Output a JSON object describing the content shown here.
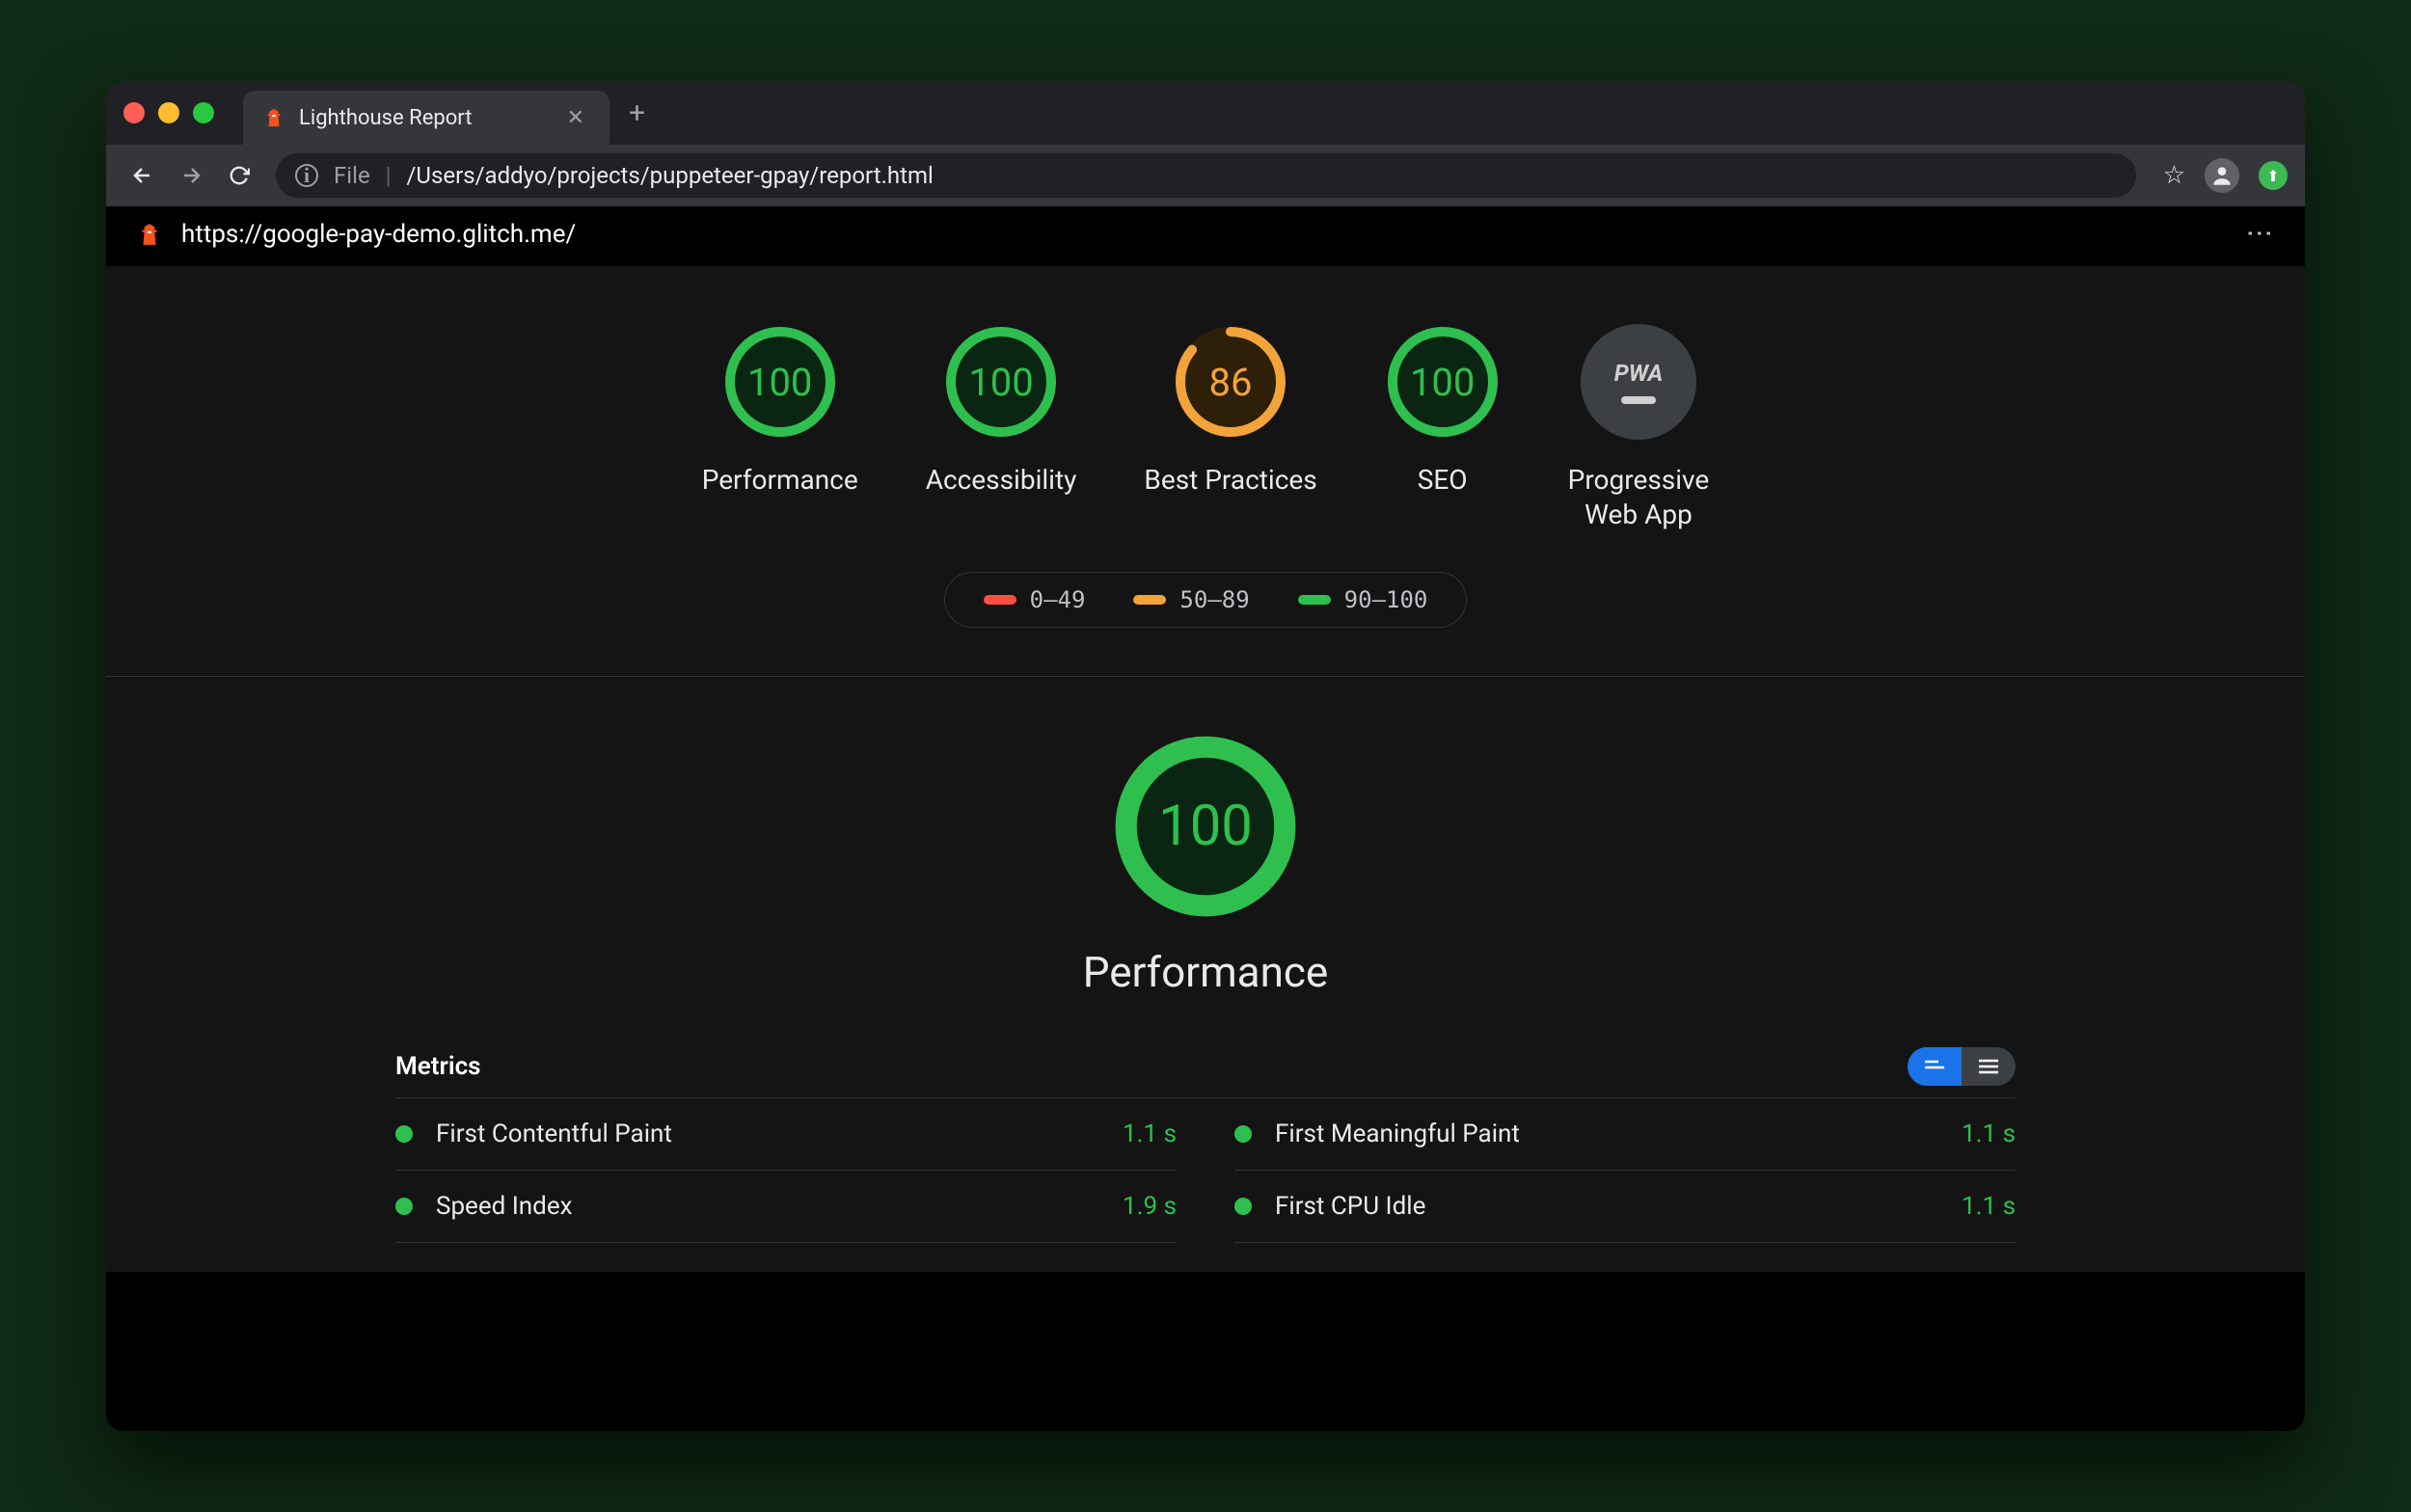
{
  "browser": {
    "tab_title": "Lighthouse Report",
    "url_protocol": "File",
    "url_path": "/Users/addyo/projects/puppeteer-gpay/report.html"
  },
  "report": {
    "tested_url": "https://google-pay-demo.glitch.me/",
    "gauges": [
      {
        "label": "Performance",
        "score": 100,
        "status": "green"
      },
      {
        "label": "Accessibility",
        "score": 100,
        "status": "green"
      },
      {
        "label": "Best Practices",
        "score": 86,
        "status": "orange"
      },
      {
        "label": "SEO",
        "score": 100,
        "status": "green"
      },
      {
        "label": "Progressive\nWeb App",
        "score": null,
        "status": "gray"
      }
    ],
    "legend": [
      {
        "color": "red",
        "range": "0–49"
      },
      {
        "color": "orange",
        "range": "50–89"
      },
      {
        "color": "green",
        "range": "90–100"
      }
    ],
    "section": {
      "title": "Performance",
      "score": 100,
      "metrics_heading": "Metrics",
      "metrics": [
        {
          "name": "First Contentful Paint",
          "value": "1.1 s",
          "status": "pass"
        },
        {
          "name": "First Meaningful Paint",
          "value": "1.1 s",
          "status": "pass"
        },
        {
          "name": "Speed Index",
          "value": "1.9 s",
          "status": "pass"
        },
        {
          "name": "First CPU Idle",
          "value": "1.1 s",
          "status": "pass"
        }
      ]
    }
  }
}
